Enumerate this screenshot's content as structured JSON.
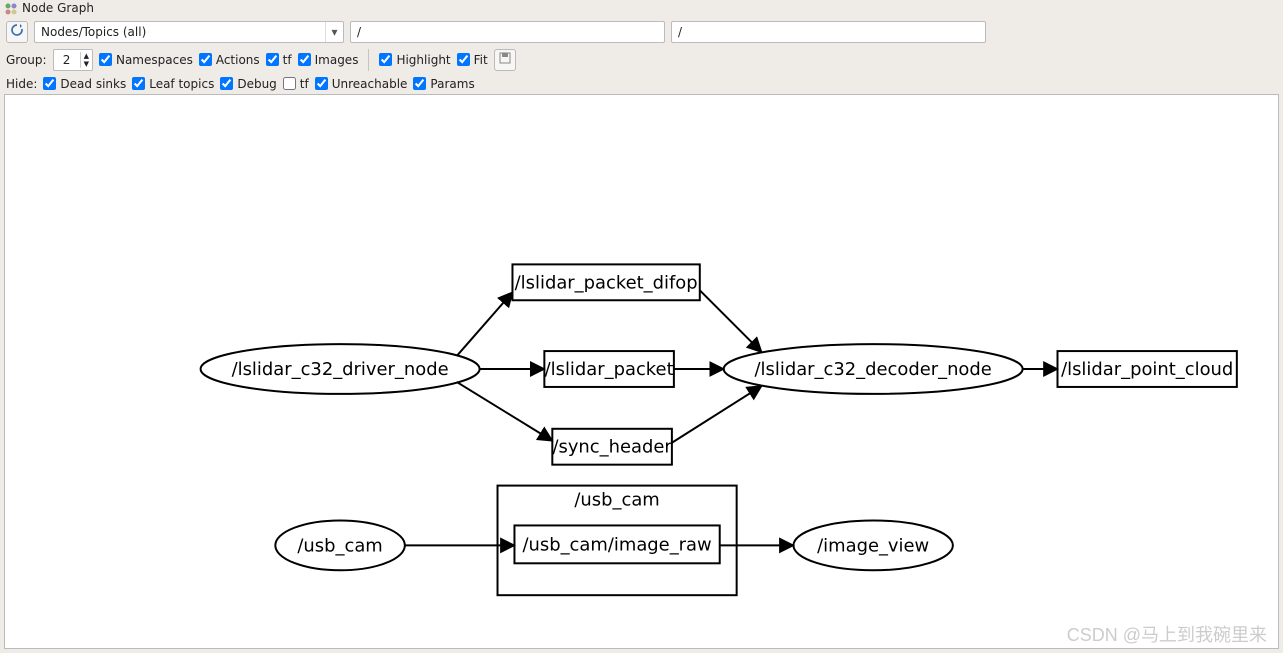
{
  "window": {
    "title": "Node Graph"
  },
  "toolbar": {
    "refresh_hint": "Refresh",
    "view_mode": "Nodes/Topics (all)",
    "filter1": "/",
    "filter2": "/"
  },
  "options_row": {
    "group_label": "Group:",
    "group_value": "2",
    "namespaces_label": "Namespaces",
    "actions_label": "Actions",
    "tf_label": "tf",
    "images_label": "Images",
    "highlight_label": "Highlight",
    "fit_label": "Fit",
    "namespaces": true,
    "actions": true,
    "tf": true,
    "images": true,
    "highlight": true,
    "fit": true
  },
  "hide_row": {
    "hide_label": "Hide:",
    "deadsinks_label": "Dead sinks",
    "leaftopics_label": "Leaf topics",
    "debug_label": "Debug",
    "tf2_label": "tf",
    "unreachable_label": "Unreachable",
    "params_label": "Params",
    "deadsinks": true,
    "leaftopics": true,
    "debug": true,
    "tf2": false,
    "unreachable": true,
    "params": true
  },
  "graph": {
    "nodes": {
      "driver": "/lslidar_c32_driver_node",
      "decoder": "/lslidar_c32_decoder_node",
      "usb_cam": "/usb_cam",
      "image_view": "/image_view"
    },
    "topics": {
      "difop": "/lslidar_packet_difop",
      "packet": "/lslidar_packet",
      "sync": "/sync_header",
      "pointcloud": "/lslidar_point_cloud",
      "usb_ns": "/usb_cam",
      "image_raw": "/usb_cam/image_raw"
    }
  },
  "watermark": "CSDN @马上到我碗里来"
}
